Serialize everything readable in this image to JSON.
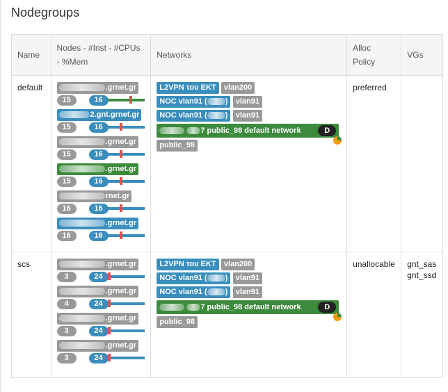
{
  "page_title": "Nodegroups",
  "columns": [
    "Name",
    "Nodes - #Inst - #CPUs - %Mem",
    "Networks",
    "Alloc Policy",
    "VGs"
  ],
  "rows": [
    {
      "name": "default",
      "alloc_policy": "preferred",
      "vgs": [],
      "nodes": [
        {
          "host_suffix": ".grnet.gr",
          "host_color": "gray",
          "instances": "15",
          "cpus": "16",
          "mem_percent": 60,
          "bar_color": "green"
        },
        {
          "host_suffix": "2.gnt.grnet.gr",
          "host_color": "blue",
          "instances": "15",
          "cpus": "16",
          "mem_percent": 35,
          "bar_color": "blue"
        },
        {
          "host_suffix": ".grnet.gr",
          "host_color": "gray",
          "instances": "15",
          "cpus": "16",
          "mem_percent": 35,
          "bar_color": "blue"
        },
        {
          "host_suffix": ".grnet.gr",
          "host_color": "green",
          "instances": "15",
          "cpus": "16",
          "mem_percent": 35,
          "bar_color": "blue"
        },
        {
          "host_suffix": "rnet.gr",
          "host_color": "gray",
          "instances": "16",
          "cpus": "16",
          "mem_percent": 35,
          "bar_color": "blue"
        },
        {
          "host_suffix": ".grnet.gr",
          "host_color": "blue",
          "instances": "16",
          "cpus": "16",
          "mem_percent": 35,
          "bar_color": "blue"
        }
      ],
      "networks": {
        "l2vpn": "L2VPN του ΕΚΤ",
        "l2vpn_vlan": "vlan200",
        "noc1_prefix": "NOC vlan91 (",
        "noc1_suffix": ")",
        "noc1_vlan": "vlan91",
        "noc2_prefix": "NOC vlan91 (",
        "noc2_suffix": ")",
        "noc2_vlan": "vlan91",
        "public_mid": "7 public_98 default network",
        "public_badge": "D",
        "public_link": "public_98"
      }
    },
    {
      "name": "scs",
      "alloc_policy": "unallocable",
      "vgs": [
        "gnt_sas",
        "gnt_ssd"
      ],
      "nodes": [
        {
          "host_suffix": ".grnet.gr",
          "host_color": "gray",
          "instances": "3",
          "cpus": "24",
          "mem_percent": 5,
          "bar_color": "blue"
        },
        {
          "host_suffix": ".grnet.gr",
          "host_color": "gray",
          "instances": "4",
          "cpus": "24",
          "mem_percent": 5,
          "bar_color": "blue"
        },
        {
          "host_suffix": ".grnet.gr",
          "host_color": "gray",
          "instances": "3",
          "cpus": "24",
          "mem_percent": 5,
          "bar_color": "blue"
        },
        {
          "host_suffix": ".grnet.gr",
          "host_color": "gray",
          "instances": "3",
          "cpus": "24",
          "mem_percent": 5,
          "bar_color": "blue"
        }
      ],
      "networks": {
        "l2vpn": "L2VPN του ΕΚΤ",
        "l2vpn_vlan": "vlan200",
        "noc1_prefix": "NOC vlan91 (",
        "noc1_suffix": ")",
        "noc1_vlan": "vlan91",
        "noc2_prefix": "NOC vlan91 (",
        "noc2_suffix": ")",
        "noc2_vlan": "vlan91",
        "public_mid": "7 public_98 default network",
        "public_badge": "D",
        "public_link": "public_98"
      }
    }
  ],
  "colors": {
    "blue": "#3a8ebd",
    "gray": "#999999",
    "green": "#3c8a3c",
    "mem_marker": "#d9534f"
  }
}
